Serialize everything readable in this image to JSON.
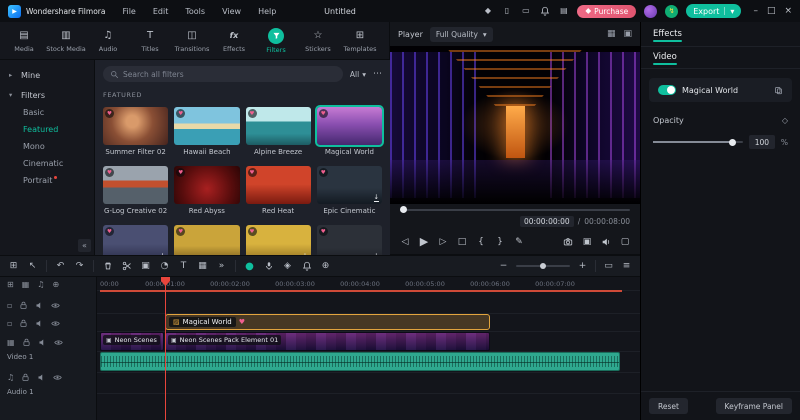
{
  "colors": {
    "accent": "#0fbf9e",
    "purchase_pink": "#e05570",
    "clip_orange": "#e2a43e",
    "playhead_red": "#e8453c",
    "audio_clip_teal": "#2fa88f"
  },
  "icons": {
    "logo_play": "▶",
    "promo": "◆",
    "device": "▯",
    "screen": "▭",
    "layout": "▤",
    "credits": "↯",
    "minimize": "–",
    "maximize": "□",
    "close": "×",
    "chevron_down": "▾",
    "chevron_right": "▸",
    "collapse": "«",
    "more_dots": "⋯",
    "menu": "≡",
    "tab_media": "▤",
    "tab_stock": "▥",
    "tab_audio": "♫",
    "tab_titles": "T",
    "tab_transitions": "◫",
    "tab_effects": "fx",
    "tab_stickers": "☆",
    "tab_templates": "⊞",
    "heart": "♥",
    "download": "↓",
    "select": "↖",
    "grid": "⊞",
    "undo": "↶",
    "redo": "↷",
    "crop": "▣",
    "speed": "◔",
    "text_tool": "T",
    "panels": "▦",
    "chevrons_more": "»",
    "record": "●",
    "marker": "◈",
    "zoom_out": "−",
    "zoom_in": "+",
    "fit": "▭",
    "keyframe": "◇",
    "prev_frame": "◁",
    "play": "▶",
    "next_frame": "▷",
    "stop": "□",
    "mark_in": "{",
    "mark_out": "}",
    "pen": "✎",
    "expand": "▢",
    "split_screen": "▦",
    "mask": "▣",
    "track_video": "▦",
    "track_audio": "♫",
    "track_plain": "▫",
    "add": "⊕"
  },
  "titlebar": {
    "app_name": "Wondershare Filmora",
    "menus": [
      "File",
      "Edit",
      "Tools",
      "View",
      "Help"
    ],
    "project_name": "Untitled",
    "purchase_label": "Purchase",
    "export_label": "Export"
  },
  "media_tabs": {
    "items": [
      "Media",
      "Stock Media",
      "Audio",
      "Titles",
      "Transitions",
      "Effects",
      "Filters",
      "Stickers",
      "Templates"
    ],
    "active": "Filters"
  },
  "sidebar": {
    "mine_label": "Mine",
    "filters_label": "Filters",
    "children": [
      "Basic",
      "Featured",
      "Mono",
      "Cinematic",
      "Portrait"
    ],
    "active_child": "Featured"
  },
  "filters_panel": {
    "search_placeholder": "Search all filters",
    "filter_all": "All",
    "section_title": "FEATURED",
    "items": [
      {
        "name": "Summer Filter 02"
      },
      {
        "name": "Hawaii Beach"
      },
      {
        "name": "Alpine Breeze"
      },
      {
        "name": "Magical World",
        "selected": true
      },
      {
        "name": "G-Log Creative 02"
      },
      {
        "name": "Red Abyss"
      },
      {
        "name": "Red Heat"
      },
      {
        "name": "Epic Cinematic"
      }
    ]
  },
  "player": {
    "label": "Player",
    "quality": "Full Quality",
    "current_time": "00:00:00:00",
    "separator": "/",
    "total_time": "00:00:08:00"
  },
  "effects_panel": {
    "tab_label": "Effects",
    "subtab_label": "Video",
    "effect_name": "Magical World",
    "opacity_label": "Opacity",
    "opacity_value": "100",
    "opacity_unit": "%",
    "reset_label": "Reset",
    "keyframe_panel_label": "Keyframe Panel"
  },
  "timeline": {
    "ruler": [
      "00:00",
      "00:00:01:00",
      "00:00:02:00",
      "00:00:03:00",
      "00:00:04:00",
      "00:00:05:00",
      "00:00:06:00",
      "00:00:07:00"
    ],
    "filter_clip_label": "Magical World",
    "video_clip_1_label": "Neon Scenes",
    "video_clip_2_label": "Neon Scenes Pack Element 01",
    "video_track_label": "Video 1",
    "audio_track_label": "Audio 1"
  }
}
